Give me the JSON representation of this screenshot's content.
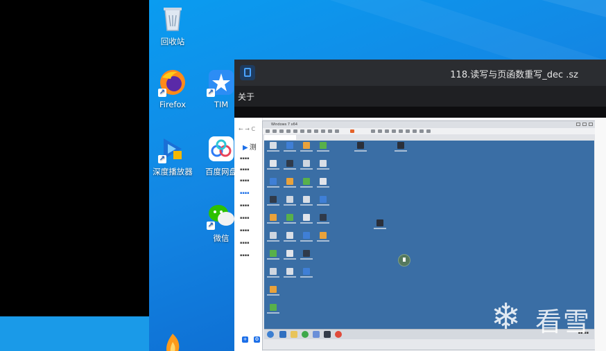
{
  "desktop": {
    "icons": [
      {
        "label": "回收站"
      },
      {
        "label": "Firefox"
      },
      {
        "label": "TIM"
      },
      {
        "label": "深度播放器"
      },
      {
        "label": "百度网盘"
      },
      {
        "label": "微信"
      }
    ]
  },
  "app": {
    "title": "118.读写与页函数重写_dec .sz",
    "menu_about": "关于"
  },
  "inner": {
    "logo": "测",
    "nav": "← → C",
    "vm_tab": "Windows 7 x64"
  },
  "watermark": {
    "text": "看雪"
  },
  "colors": {
    "desktop_blue": "#1387e4",
    "title_bar": "#2b2d31",
    "menu_bar": "#1f2023",
    "vm_screen": "#3a6ea5",
    "accent": "#1c6fe8"
  }
}
